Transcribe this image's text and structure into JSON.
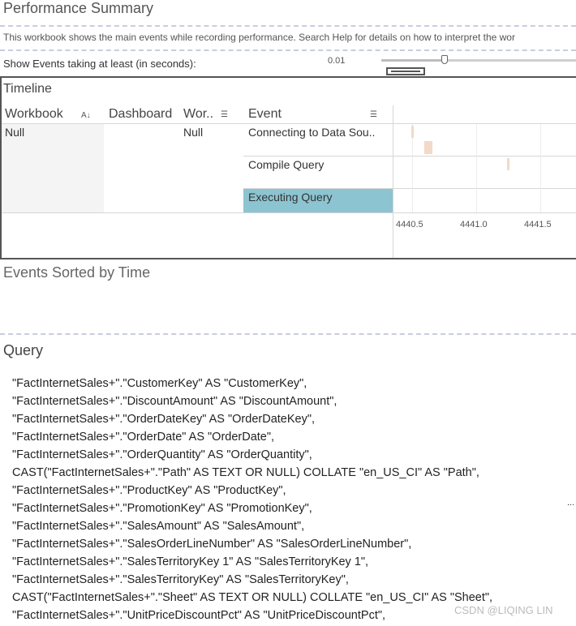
{
  "header": {
    "title": "Performance Summary",
    "description": "This workbook shows the main events while recording performance. Search Help for details on how to interpret the wor",
    "filter_label": "Show Events taking at least (in seconds):",
    "filter_value": "0.01",
    "slider_value": 0.01
  },
  "timeline": {
    "title": "Timeline",
    "columns": [
      "Workbook",
      "Dashboard",
      "Wor..",
      "Event"
    ],
    "workbook": "Null",
    "worksheet": "Null",
    "events": [
      "Connecting to Data Sou..",
      "Compile Query",
      "Executing Query"
    ],
    "selected_event": "Executing Query",
    "axis_ticks": [
      "4440.5",
      "4441.0",
      "4441.5"
    ]
  },
  "events_sorted": {
    "title": "Events Sorted by Time"
  },
  "query": {
    "title": "Query",
    "lines": [
      "\"FactInternetSales+\".\"CustomerKey\" AS \"CustomerKey\",",
      "\"FactInternetSales+\".\"DiscountAmount\" AS \"DiscountAmount\",",
      "\"FactInternetSales+\".\"OrderDateKey\" AS \"OrderDateKey\",",
      "\"FactInternetSales+\".\"OrderDate\" AS \"OrderDate\",",
      "\"FactInternetSales+\".\"OrderQuantity\" AS \"OrderQuantity\",",
      "CAST(\"FactInternetSales+\".\"Path\" AS TEXT OR NULL) COLLATE \"en_US_CI\" AS \"Path\",",
      "\"FactInternetSales+\".\"ProductKey\" AS \"ProductKey\",",
      "\"FactInternetSales+\".\"PromotionKey\" AS \"PromotionKey\",",
      "\"FactInternetSales+\".\"SalesAmount\" AS \"SalesAmount\",",
      "\"FactInternetSales+\".\"SalesOrderLineNumber\" AS \"SalesOrderLineNumber\",",
      "\"FactInternetSales+\".\"SalesTerritoryKey 1\" AS \"SalesTerritoryKey 1\",",
      "\"FactInternetSales+\".\"SalesTerritoryKey\" AS \"SalesTerritoryKey\",",
      "CAST(\"FactInternetSales+\".\"Sheet\" AS TEXT OR NULL) COLLATE \"en_US_CI\" AS \"Sheet\",",
      "\"FactInternetSales+\".\"UnitPriceDiscountPct\" AS \"UnitPriceDiscountPct\","
    ],
    "more_indicator": "..."
  },
  "watermark": "CSDN @LIQING LIN"
}
